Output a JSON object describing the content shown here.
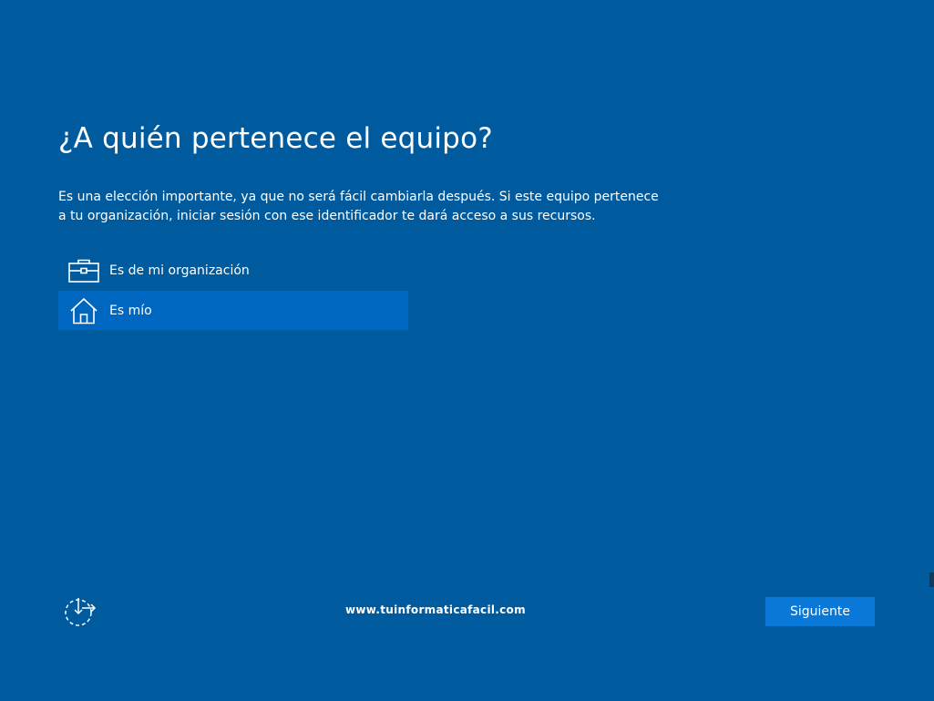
{
  "oobe": {
    "title": "¿A quién pertenece el equipo?",
    "description": "Es una elección importante, ya que no será fácil cambiarla después. Si este equipo pertenece a tu organización, iniciar sesión con ese identificador te dará acceso a sus recursos.",
    "options": [
      {
        "label": "Es de mi organización",
        "icon": "briefcase-icon",
        "selected": false
      },
      {
        "label": "Es mío",
        "icon": "home-icon",
        "selected": true
      }
    ],
    "ease_of_access_icon": "ease-of-access-icon",
    "watermark": "www.tuinformaticafacil.com",
    "next_label": "Siguiente"
  },
  "colors": {
    "background": "#005a9e",
    "selected_option": "#0067c0",
    "button": "#0a78d7",
    "text": "#ffffff"
  }
}
